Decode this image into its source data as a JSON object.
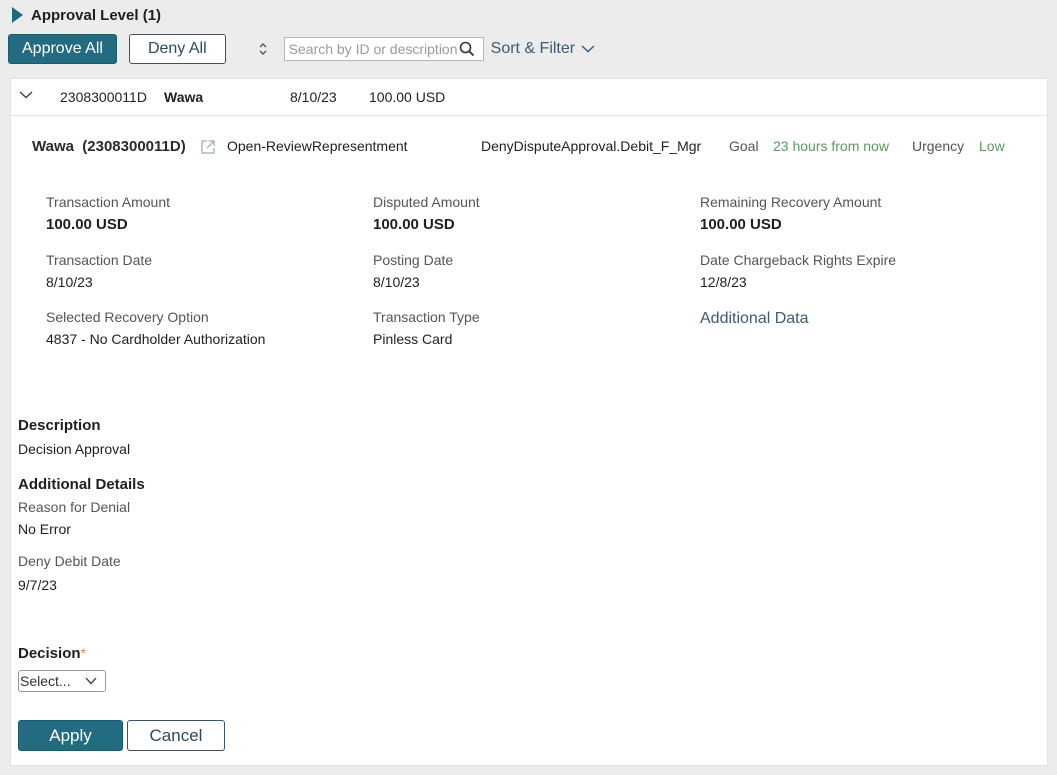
{
  "section": {
    "title": "Approval Level (1)"
  },
  "toolbar": {
    "approve_all": "Approve All",
    "deny_all": "Deny All",
    "search_placeholder": "Search by ID or description",
    "sort_filter": "Sort & Filter"
  },
  "row": {
    "id": "2308300011D",
    "name": "Wawa",
    "date": "8/10/23",
    "amount": "100.00 USD"
  },
  "detail": {
    "title": "Wawa  (2308300011D)",
    "status": "Open-ReviewRepresentment",
    "flow": "DenyDisputeApproval.Debit_F_Mgr",
    "goal_label": "Goal",
    "goal_value": "23 hours from now",
    "urgency_label": "Urgency",
    "urgency_value": "Low"
  },
  "fields": {
    "transaction_amount": {
      "label": "Transaction Amount",
      "value": "100.00 USD"
    },
    "disputed_amount": {
      "label": "Disputed Amount",
      "value": "100.00 USD"
    },
    "remaining_recovery": {
      "label": "Remaining Recovery Amount",
      "value": "100.00 USD"
    },
    "transaction_date": {
      "label": "Transaction Date",
      "value": "8/10/23"
    },
    "posting_date": {
      "label": "Posting Date",
      "value": "8/10/23"
    },
    "chargeback_expire": {
      "label": "Date Chargeback Rights Expire",
      "value": "12/8/23"
    },
    "recovery_option": {
      "label": "Selected Recovery Option",
      "value": "4837 - No Cardholder Authorization"
    },
    "transaction_type": {
      "label": "Transaction Type",
      "value": "Pinless Card"
    },
    "additional_data_link": "Additional Data"
  },
  "description": {
    "heading": "Description",
    "value": "Decision Approval"
  },
  "additional_details": {
    "heading": "Additional Details",
    "reason_label": "Reason for Denial",
    "reason_value": "No Error",
    "deny_date_label": "Deny Debit Date",
    "deny_date_value": "9/7/23"
  },
  "decision": {
    "label": "Decision",
    "required_mark": "*",
    "selected": "Select..."
  },
  "actions": {
    "apply": "Apply",
    "cancel": "Cancel"
  },
  "colors": {
    "primary": "#226b81",
    "link": "#3d5a7a",
    "positive": "#5a9a63",
    "required": "#e08a2b"
  }
}
